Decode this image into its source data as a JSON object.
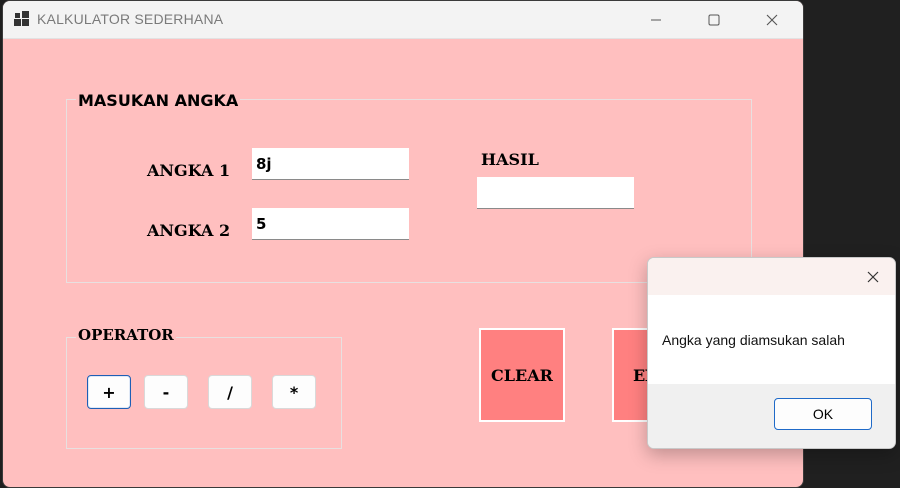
{
  "window": {
    "title": "KALKULATOR SEDERHANA",
    "app_icon": "window-app-icon",
    "controls": [
      "minimize-icon",
      "maximize-icon",
      "close-icon"
    ],
    "background_color": "#ffbfbf"
  },
  "input_group": {
    "title": "MASUKAN ANGKA",
    "angka1_label": "ANGKA 1",
    "angka1_value": "8j",
    "angka2_label": "ANGKA 2",
    "angka2_value": "5",
    "hasil_label": "HASIL",
    "hasil_value": ""
  },
  "operator_group": {
    "title": "OPERATOR",
    "buttons": [
      "+",
      "-",
      "/",
      "*"
    ]
  },
  "actions": {
    "clear_label": "CLEAR",
    "exit_label": "EXIT",
    "button_color": "#ff8080"
  },
  "dialog": {
    "message": "Angka yang diamsukan salah",
    "ok_label": "OK"
  }
}
